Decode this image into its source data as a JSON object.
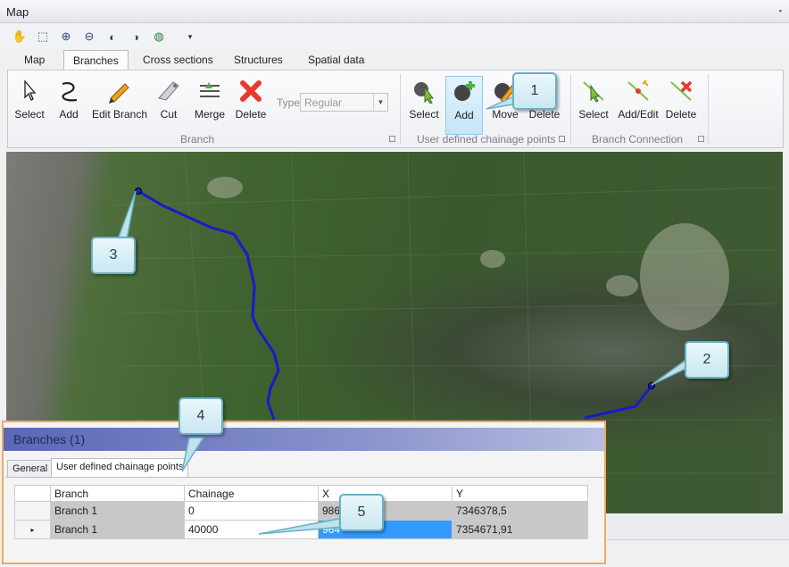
{
  "window": {
    "title": "Map",
    "pin_icon": "pin-icon"
  },
  "toolbar": {
    "icons": [
      "pan-hand-icon",
      "zoom-box-icon",
      "zoom-in-icon",
      "zoom-out-icon",
      "zoom-previous-icon",
      "zoom-next-icon",
      "globe-icon",
      "overflow-icon"
    ]
  },
  "tabs": [
    "Map",
    "Branches",
    "Cross sections",
    "Structures",
    "Spatial data"
  ],
  "active_tab": "Branches",
  "ribbon": {
    "branch_group": {
      "label": "Branch",
      "buttons": [
        "Select",
        "Add",
        "Edit Branch",
        "Cut",
        "Merge",
        "Delete"
      ],
      "type_label": "Type",
      "type_value": "Regular"
    },
    "chainage_group": {
      "label": "User defined chainage points",
      "buttons": [
        "Select",
        "Add",
        "Move",
        "Delete"
      ]
    },
    "connection_group": {
      "label": "Branch Connection",
      "buttons": [
        "Select",
        "Add/Edit",
        "Delete"
      ]
    },
    "colors": {
      "delete_red": "#e53a2c",
      "select_green": "#7ac142",
      "add_green": "#4caf50",
      "edit_orange": "#f0a11b"
    }
  },
  "map": {
    "branch_color": "#1a1acc"
  },
  "panel": {
    "title": "Branches (1)",
    "tabs": [
      "General",
      "User defined chainage points"
    ],
    "active_tab": "User defined chainage points",
    "columns": [
      "Branch",
      "Chainage",
      "X",
      "Y"
    ],
    "rows": [
      {
        "branch": "Branch 1",
        "chainage": "0",
        "x": "986",
        "y": "7346378,5"
      },
      {
        "branch": "Branch 1",
        "chainage": "40000",
        "x": "964",
        "y": "7354671,91"
      }
    ],
    "current_row_marker": "▸"
  },
  "callouts": [
    "1",
    "2",
    "3",
    "4",
    "5"
  ]
}
